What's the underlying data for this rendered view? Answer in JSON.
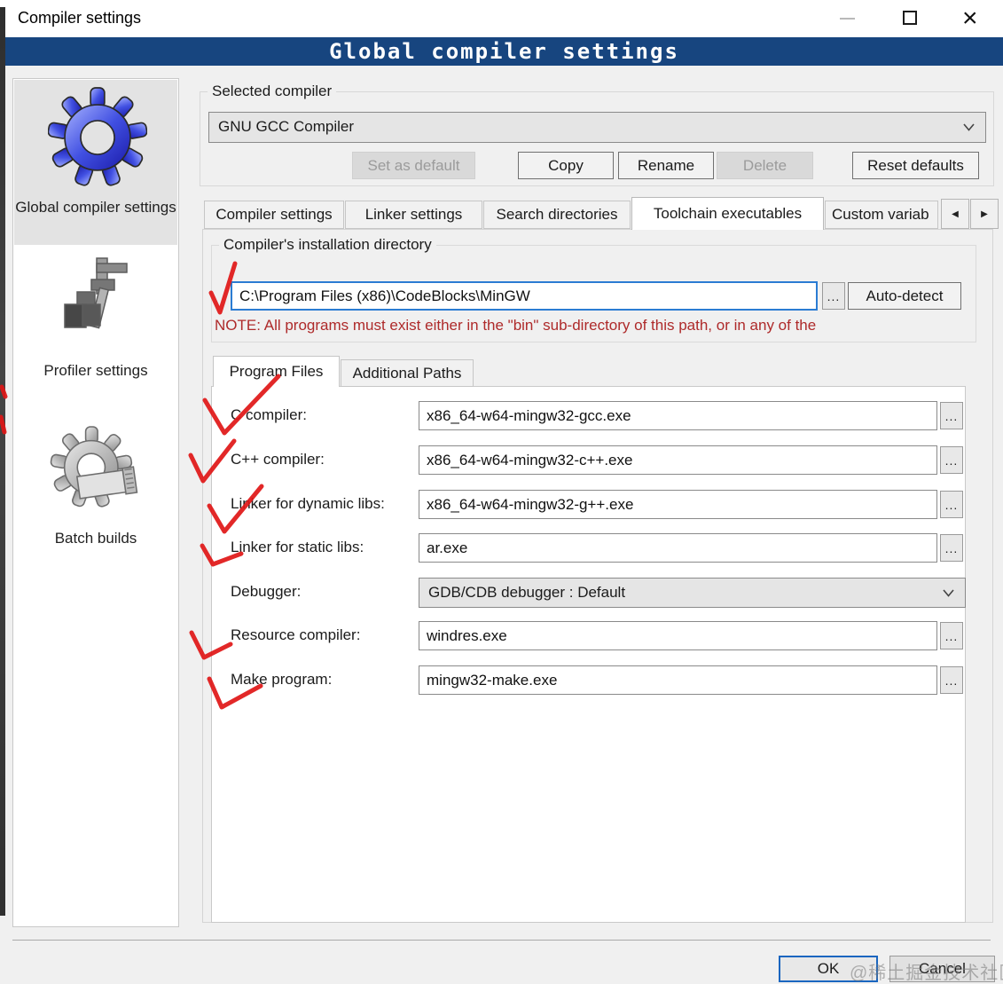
{
  "window": {
    "title": "Compiler settings"
  },
  "header": {
    "title": "Global compiler settings"
  },
  "sidebar": {
    "items": [
      {
        "label": "Global compiler settings",
        "icon": "blue-gear-icon",
        "selected": true
      },
      {
        "label": "Profiler settings",
        "icon": "caliper-icon",
        "selected": false
      },
      {
        "label": "Batch builds",
        "icon": "gray-gear-icon",
        "selected": false
      }
    ]
  },
  "selected_compiler": {
    "group_title": "Selected compiler",
    "value": "GNU GCC Compiler",
    "buttons": {
      "set_default": "Set as default",
      "copy": "Copy",
      "rename": "Rename",
      "delete": "Delete",
      "reset": "Reset defaults"
    },
    "disabled_buttons": [
      "Set as default",
      "Delete"
    ]
  },
  "tabs": {
    "compiler": "Compiler settings",
    "linker": "Linker settings",
    "search": "Search directories",
    "toolchain": "Toolchain executables",
    "custom": "Custom variab",
    "active": "Toolchain executables",
    "scroll_left": "◀",
    "scroll_right": "▶"
  },
  "toolchain": {
    "group_title": "Compiler's installation directory",
    "path_value": "C:\\Program Files (x86)\\CodeBlocks\\MinGW",
    "browse": "...",
    "autodetect": "Auto-detect",
    "note": "NOTE: All programs must exist either in the \"bin\" sub-directory of this path, or in any of the",
    "subtabs": {
      "program_files": "Program Files",
      "additional_paths": "Additional Paths",
      "active": "Program Files"
    },
    "rows": [
      {
        "label": "C compiler:",
        "value": "x86_64-w64-mingw32-gcc.exe",
        "type": "input"
      },
      {
        "label": "C++ compiler:",
        "value": "x86_64-w64-mingw32-c++.exe",
        "type": "input"
      },
      {
        "label": "Linker for dynamic libs:",
        "value": "x86_64-w64-mingw32-g++.exe",
        "type": "input"
      },
      {
        "label": "Linker for static libs:",
        "value": "ar.exe",
        "type": "input"
      },
      {
        "label": "Debugger:",
        "value": "GDB/CDB debugger : Default",
        "type": "select"
      },
      {
        "label": "Resource compiler:",
        "value": "windres.exe",
        "type": "input"
      },
      {
        "label": "Make program:",
        "value": "mingw32-make.exe",
        "type": "input"
      }
    ]
  },
  "footer": {
    "ok": "OK",
    "cancel": "Cancel",
    "watermark": "@稀土掘金技术社区"
  },
  "colors": {
    "header_bg": "#17457f",
    "note_red": "#ae2a2a",
    "annotation_red": "#e01616",
    "focus_border": "#2b7cd3"
  }
}
